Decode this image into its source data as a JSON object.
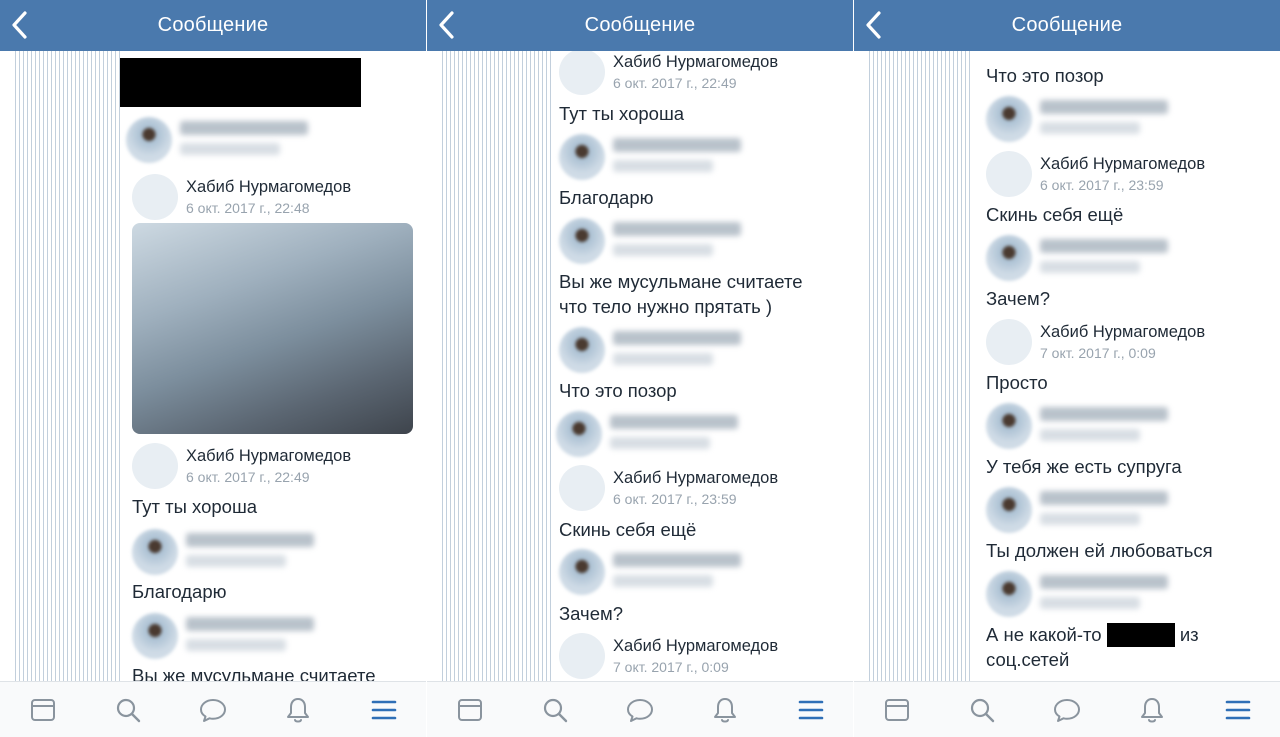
{
  "header": {
    "title": "Сообщение"
  },
  "colors": {
    "header_bg": "#4a79ad",
    "tab_active": "#2f6fb6",
    "tab_inactive": "#8a949e",
    "date": "#98a3ae"
  },
  "tabs": [
    {
      "icon": "news-icon",
      "active": false
    },
    {
      "icon": "search-icon",
      "active": false
    },
    {
      "icon": "messages-icon",
      "active": false
    },
    {
      "icon": "notifications-icon",
      "active": false
    },
    {
      "icon": "menu-icon",
      "active": true
    }
  ],
  "khabib": {
    "name": "Хабиб Нурмагомедов"
  },
  "panel1": {
    "khabib_date_1": "6 окт. 2017 г., 22:48",
    "khabib_date_2": "6 окт. 2017 г., 22:49",
    "text_1": "Тут ты хороша",
    "text_2": "Благодарю",
    "text_3": "Вы же мусульмане считаете"
  },
  "panel2": {
    "khabib_date_1": "6 окт. 2017 г., 22:49",
    "text_1": "Тут ты хороша",
    "text_2": "Благодарю",
    "text_3a": "Вы же мусульмане считаете",
    "text_3b": "что тело нужно прятать )",
    "text_4": "Что это позор",
    "khabib_date_2": "6 окт. 2017 г., 23:59",
    "text_5": "Скинь себя ещё",
    "text_6": "Зачем?",
    "khabib_date_3": "7 окт. 2017 г., 0:09"
  },
  "panel3": {
    "text_1": "Что это позор",
    "khabib_date_1": "6 окт. 2017 г., 23:59",
    "text_2": "Скинь себя ещё",
    "text_3": "Зачем?",
    "khabib_date_2": "7 окт. 2017 г., 0:09",
    "text_4": "Просто",
    "text_5": "У тебя же есть супруга",
    "text_6": "Ты должен ей любоваться",
    "text_7a": "А не какой-то",
    "text_7b": "из",
    "text_7c": "соц.сетей"
  }
}
